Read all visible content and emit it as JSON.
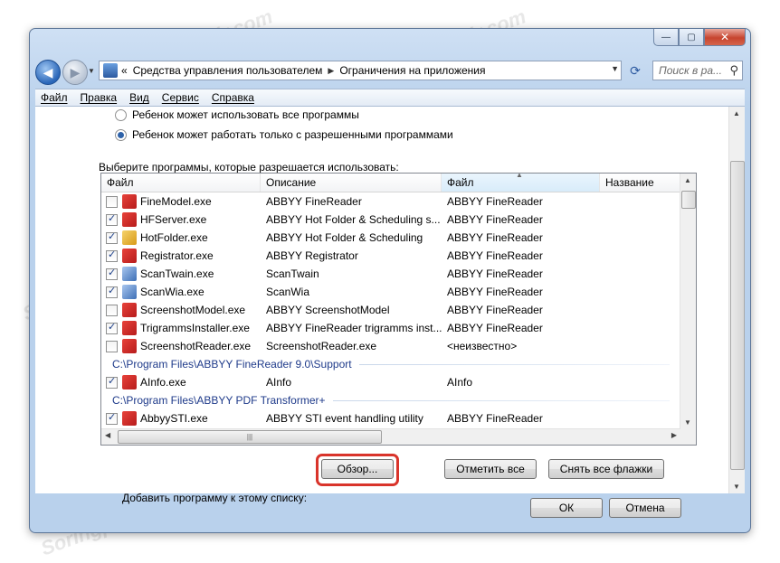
{
  "window": {
    "breadcrumb": [
      "Средства управления пользователем",
      "Ограничения на приложения"
    ],
    "breadcrumb_prefix": "«",
    "search_placeholder": "Поиск в ра...",
    "caption": {
      "minimize": "—",
      "maximize": "▢",
      "close": "✕"
    }
  },
  "menu": [
    "Файл",
    "Правка",
    "Вид",
    "Сервис",
    "Справка"
  ],
  "options": {
    "radio1": "Ребенок может использовать все программы",
    "radio2": "Ребенок может работать только с разрешенными программами",
    "selected": 2
  },
  "list_prompt": "Выберите программы, которые разрешается использовать:",
  "list": {
    "columns": [
      "Файл",
      "Описание",
      "Файл",
      "Название"
    ],
    "rows": [
      {
        "file": "FineModel.exe",
        "desc": "ABBYY FineReader",
        "product": "ABBYY FineReader",
        "checked": false,
        "icon": "app-icon"
      },
      {
        "file": "HFServer.exe",
        "desc": "ABBYY Hot Folder & Scheduling s...",
        "product": "ABBYY FineReader",
        "checked": true,
        "icon": "app-icon"
      },
      {
        "file": "HotFolder.exe",
        "desc": "ABBYY Hot Folder & Scheduling",
        "product": "ABBYY FineReader",
        "checked": true,
        "icon": "folder-app-icon"
      },
      {
        "file": "Registrator.exe",
        "desc": "ABBYY Registrator",
        "product": "ABBYY FineReader",
        "checked": true,
        "icon": "app-icon"
      },
      {
        "file": "ScanTwain.exe",
        "desc": "ScanTwain",
        "product": "ABBYY FineReader",
        "checked": true,
        "icon": "scanner-icon"
      },
      {
        "file": "ScanWia.exe",
        "desc": "ScanWia",
        "product": "ABBYY FineReader",
        "checked": true,
        "icon": "scanner-icon"
      },
      {
        "file": "ScreenshotModel.exe",
        "desc": "ABBYY ScreenshotModel",
        "product": "ABBYY FineReader",
        "checked": false,
        "icon": "app-icon"
      },
      {
        "file": "TrigrammsInstaller.exe",
        "desc": "ABBYY FineReader trigramms inst...",
        "product": "ABBYY FineReader",
        "checked": true,
        "icon": "app-icon"
      },
      {
        "file": "ScreenshotReader.exe",
        "desc": "ScreenshotReader.exe",
        "product": "<неизвестно>",
        "checked": false,
        "icon": "app-icon"
      }
    ],
    "group1": "C:\\Program Files\\ABBYY FineReader 9.0\\Support",
    "group1_rows": [
      {
        "file": "AInfo.exe",
        "desc": "AInfo",
        "product": "AInfo",
        "checked": true,
        "icon": "app-icon"
      }
    ],
    "group2": "C:\\Program Files\\ABBYY PDF Transformer+",
    "group2_rows": [
      {
        "file": "AbbyySTI.exe",
        "desc": "ABBYY STI event handling utility",
        "product": "ABBYY FineReader",
        "checked": true,
        "icon": "app-icon"
      }
    ]
  },
  "actions": {
    "add_label": "Добавить программу к этому списку:",
    "browse": "Обзор...",
    "check_all": "Отметить все",
    "uncheck_all": "Снять все флажки"
  },
  "footer": {
    "ok": "ОК",
    "cancel": "Отмена"
  },
  "watermark": "Soringpcrepair.com"
}
